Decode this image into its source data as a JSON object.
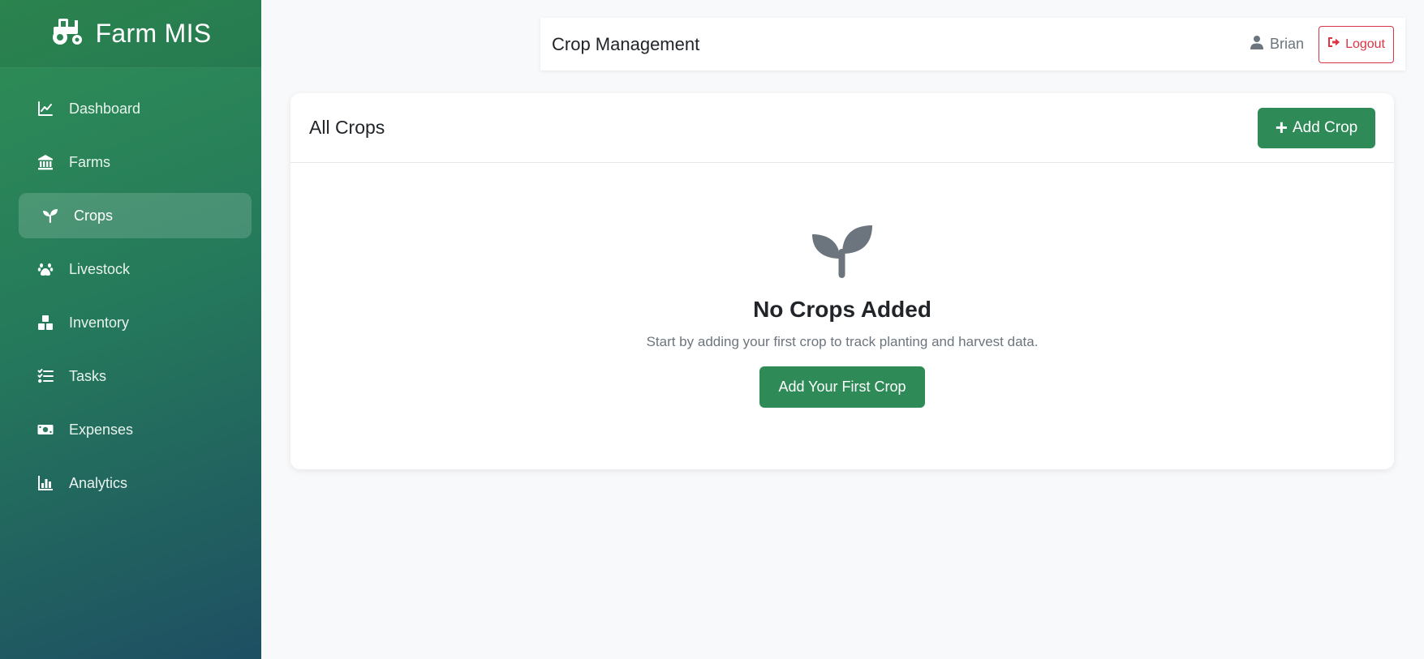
{
  "brand": {
    "title": "Farm MIS",
    "icon": "tractor-icon"
  },
  "sidebar": {
    "items": [
      {
        "label": "Dashboard",
        "icon": "chart-line-icon",
        "active": false
      },
      {
        "label": "Farms",
        "icon": "building-icon",
        "active": false
      },
      {
        "label": "Crops",
        "icon": "seedling-icon",
        "active": true
      },
      {
        "label": "Livestock",
        "icon": "paw-icon",
        "active": false
      },
      {
        "label": "Inventory",
        "icon": "boxes-icon",
        "active": false
      },
      {
        "label": "Tasks",
        "icon": "tasks-icon",
        "active": false
      },
      {
        "label": "Expenses",
        "icon": "money-bill-icon",
        "active": false
      },
      {
        "label": "Analytics",
        "icon": "chart-bar-icon",
        "active": false
      }
    ]
  },
  "topbar": {
    "title": "Crop Management",
    "user_name": "Brian",
    "logout_label": "Logout"
  },
  "card": {
    "title": "All Crops",
    "add_button_plus": "+",
    "add_button_label": "Add Crop",
    "empty_title": "No Crops Added",
    "empty_description": "Start by adding your first crop to track planting and harvest data.",
    "empty_button_label": "Add Your First Crop"
  },
  "colors": {
    "primary_green": "#2e8b57",
    "danger": "#dc3545",
    "muted_text": "#6c757d",
    "page_bg": "#f8f9fa"
  }
}
